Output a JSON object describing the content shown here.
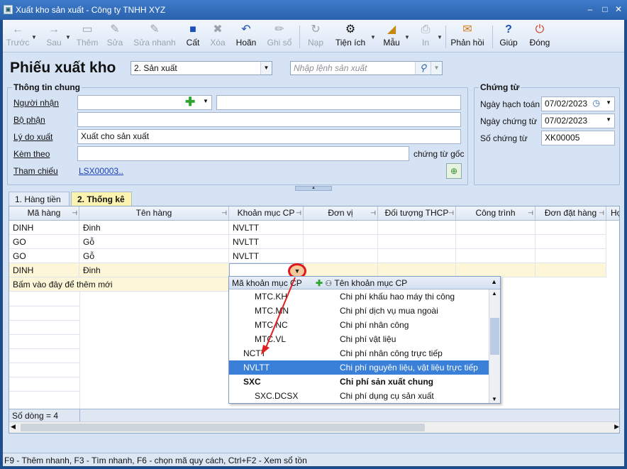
{
  "window": {
    "title": "Xuất kho sản xuất - Công ty TNHH XYZ"
  },
  "toolbar": [
    {
      "label": "Trước",
      "icon": "←",
      "enabled": false
    },
    {
      "label": "Sau",
      "icon": "→",
      "enabled": false
    },
    {
      "label": "Thêm",
      "icon": "▭",
      "enabled": false
    },
    {
      "label": "Sửa",
      "icon": "✎",
      "enabled": false
    },
    {
      "label": "Sửa nhanh",
      "icon": "✎",
      "enabled": false
    },
    {
      "label": "Cất",
      "icon": "■",
      "enabled": true
    },
    {
      "label": "Xóa",
      "icon": "✖",
      "enabled": false
    },
    {
      "label": "Hoãn",
      "icon": "↶",
      "enabled": true
    },
    {
      "label": "Ghi sổ",
      "icon": "✏",
      "enabled": false
    },
    {
      "label": "Nạp",
      "icon": "↻",
      "enabled": false
    },
    {
      "label": "Tiện ích",
      "icon": "⚙",
      "enabled": true
    },
    {
      "label": "Mẫu",
      "icon": "◢",
      "enabled": true
    },
    {
      "label": "In",
      "icon": "⎙",
      "enabled": false
    },
    {
      "label": "Phản hồi",
      "icon": "✉",
      "enabled": true
    },
    {
      "label": "Giúp",
      "icon": "?",
      "enabled": true
    },
    {
      "label": "Đóng",
      "icon": "⏻",
      "enabled": true
    }
  ],
  "header": {
    "title": "Phiếu xuất kho",
    "type_value": "2. Sản xuất",
    "command_placeholder": "Nhập lệnh sản xuất"
  },
  "general": {
    "title": "Thông tin chung",
    "recipient_label": "Người nhận",
    "recipient_value": "",
    "recipient_name": "",
    "department_label": "Bộ phận",
    "department_value": "",
    "reason_label": "Lý do xuất",
    "reason_value": "Xuất cho sản xuất",
    "attach_label": "Kèm theo",
    "attach_value": "",
    "attach_suffix": "chứng từ gốc",
    "ref_label": "Tham chiếu",
    "ref_value": "LSX00003",
    "ref_more": "..."
  },
  "voucher": {
    "title": "Chứng từ",
    "posting_date_label": "Ngày hạch toán",
    "posting_date": "07/02/2023",
    "voucher_date_label": "Ngày chứng từ",
    "voucher_date": "07/02/2023",
    "voucher_no_label": "Số chứng từ",
    "voucher_no": "XK00005"
  },
  "tabs": [
    "1. Hàng tiền",
    "2. Thống kê"
  ],
  "grid": {
    "columns": [
      "Mã hàng",
      "Tên hàng",
      "Khoản mục CP",
      "Đơn vị",
      "Đối tượng THCP",
      "Công trình",
      "Đơn đặt hàng",
      "Hợ"
    ],
    "rows": [
      [
        "DINH",
        "Đinh",
        "NVLTT",
        "",
        "",
        "",
        ""
      ],
      [
        "GO",
        "Gỗ",
        "NVLTT",
        "",
        "",
        "",
        ""
      ],
      [
        "GO",
        "Gỗ",
        "NVLTT",
        "",
        "",
        "",
        ""
      ],
      [
        "DINH",
        "Đinh",
        "",
        "",
        "",
        "",
        ""
      ]
    ],
    "add_row_hint": "Bấm vào đây để thêm mới",
    "row_count": "Số dòng = 4"
  },
  "popup": {
    "col_code": "Mã khoản mục CP",
    "col_name": "Tên khoản mục CP",
    "items": [
      {
        "code": "MTC.KH",
        "name": "Chi phí khấu hao máy thi công"
      },
      {
        "code": "MTC.MN",
        "name": "Chi phí dịch vụ mua ngoài"
      },
      {
        "code": "MTC.NC",
        "name": "Chi phí nhân công"
      },
      {
        "code": "MTC.VL",
        "name": "Chi phí vật liệu"
      },
      {
        "code": "NCTT",
        "name": "Chi phí nhân công trực tiếp"
      },
      {
        "code": "NVLTT",
        "name": "Chi phí nguyên liệu, vật liệu trực tiếp"
      },
      {
        "code": "SXC",
        "name": "Chi phí sản xuất chung"
      },
      {
        "code": "SXC.DCSX",
        "name": "Chi phí dụng cụ sản xuất"
      }
    ]
  },
  "footer": "F9 - Thêm nhanh, F3 - Tìm nhanh, F6 - chọn mã quy cách, Ctrl+F2 - Xem sổ tồn"
}
